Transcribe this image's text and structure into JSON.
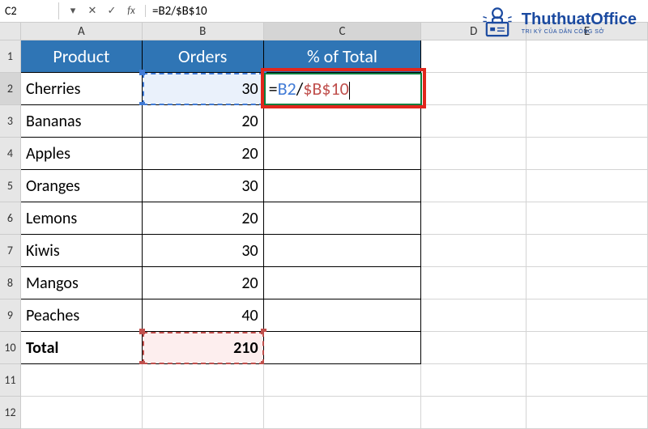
{
  "name_box": "C2",
  "formula": "=B2/$B$10",
  "formula_parts": {
    "eq": "=",
    "ref1": "B2",
    "op": "/",
    "ref2": "$B$10"
  },
  "columns": [
    "A",
    "B",
    "C",
    "D",
    "E"
  ],
  "rows": [
    "1",
    "2",
    "3",
    "4",
    "5",
    "6",
    "7",
    "8",
    "9",
    "10",
    "11",
    "12"
  ],
  "header": {
    "a": "Product",
    "b": "Orders",
    "c": "% of Total"
  },
  "data": [
    {
      "a": "Cherries",
      "b": "30"
    },
    {
      "a": "Bananas",
      "b": "20"
    },
    {
      "a": "Apples",
      "b": "20"
    },
    {
      "a": "Oranges",
      "b": "30"
    },
    {
      "a": "Lemons",
      "b": "20"
    },
    {
      "a": "Kiwis",
      "b": "30"
    },
    {
      "a": "Mangos",
      "b": "20"
    },
    {
      "a": "Peaches",
      "b": "40"
    }
  ],
  "total": {
    "label": "Total",
    "value": "210"
  },
  "branding": {
    "name": "ThuthuatOffice",
    "tagline": "TRI KỶ CỦA DÂN CÔNG SỞ"
  },
  "chart_data": {
    "type": "table",
    "title": "% of Total",
    "columns": [
      "Product",
      "Orders",
      "% of Total"
    ],
    "rows": [
      [
        "Cherries",
        30,
        null
      ],
      [
        "Bananas",
        20,
        null
      ],
      [
        "Apples",
        20,
        null
      ],
      [
        "Oranges",
        30,
        null
      ],
      [
        "Lemons",
        20,
        null
      ],
      [
        "Kiwis",
        30,
        null
      ],
      [
        "Mangos",
        20,
        null
      ],
      [
        "Peaches",
        40,
        null
      ]
    ],
    "total_row": [
      "Total",
      210,
      null
    ],
    "active_formula": "=B2/$B$10"
  }
}
